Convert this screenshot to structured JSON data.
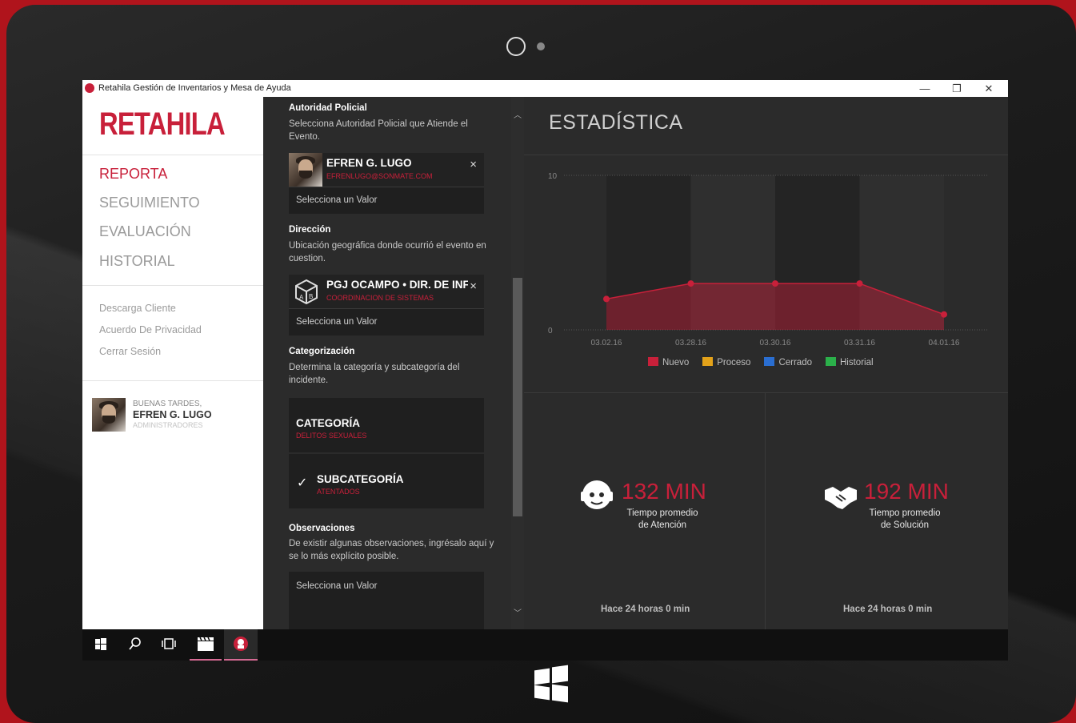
{
  "window": {
    "title": "Retahila Gestión de Inventarios y Mesa de Ayuda",
    "controls": [
      "—",
      "❐",
      "✕"
    ]
  },
  "sidebar": {
    "logo": "RETAHILA",
    "nav": [
      {
        "label": "REPORTA",
        "active": true
      },
      {
        "label": "SEGUIMIENTO",
        "active": false
      },
      {
        "label": "EVALUACIÓN",
        "active": false
      },
      {
        "label": "HISTORIAL",
        "active": false
      }
    ],
    "links": [
      "Descarga Cliente",
      "Acuerdo De Privacidad",
      "Cerrar Sesión"
    ],
    "user": {
      "greeting": "BUENAS TARDES,",
      "name": "EFREN G. LUGO",
      "role": "ADMINISTRADORES"
    }
  },
  "form": {
    "autoridad": {
      "heading": "Autoridad Policial",
      "description": "Selecciona Autoridad Policial que Atiende el Evento.",
      "card": {
        "name": "EFREN G. LUGO",
        "sub": "EFRENLUGO@SONMATE.COM"
      },
      "select": "Selecciona un Valor"
    },
    "direccion": {
      "heading": "Dirección",
      "description": "Ubicación geográfica donde ocurrió el evento en cuestion.",
      "card": {
        "name": "PGJ OCAMPO • DIR. DE INFO",
        "sub": "COORDINACION DE SISTEMAS"
      },
      "select": "Selecciona un Valor"
    },
    "categorizacion": {
      "heading": "Categorización",
      "description": "Determina la categoría y subcategoría del incidente.",
      "categoria": {
        "title": "CATEGORÍA",
        "value": "DELITOS SEXUALES"
      },
      "subcategoria": {
        "title": "SUBCATEGORÍA",
        "value": "ATENTADOS",
        "check": "✓"
      }
    },
    "observaciones": {
      "heading": "Observaciones",
      "description": "De existir algunas observaciones, ingrésalo aquí y se lo más explícito posible.",
      "select": "Selecciona un Valor"
    }
  },
  "stats": {
    "title": "ESTADÍSTICA",
    "metrics": [
      {
        "value": "132 MIN",
        "label1": "Tiempo promedio",
        "label2": "de Atención",
        "footer": "Hace 24 horas 0 min",
        "icon": "support-agent-icon"
      },
      {
        "value": "192 MIN",
        "label1": "Tiempo promedio",
        "label2": "de Solución",
        "footer": "Hace 24 horas 0 min",
        "icon": "handshake-icon"
      }
    ]
  },
  "chart_data": {
    "type": "area",
    "x": [
      "03.02.16",
      "03.28.16",
      "03.30.16",
      "03.31.16",
      "04.01.16"
    ],
    "series": [
      {
        "name": "Nuevo",
        "values": [
          2,
          3,
          3,
          3,
          1
        ],
        "color": "#c8203a"
      },
      {
        "name": "Proceso",
        "values": [],
        "color": "#e3a21a"
      },
      {
        "name": "Cerrado",
        "values": [],
        "color": "#2a6ed1"
      },
      {
        "name": "Historial",
        "values": [],
        "color": "#2bb04a"
      }
    ],
    "ylim": [
      0,
      10
    ],
    "yticks": [
      "0",
      "10"
    ],
    "legend_position": "bottom",
    "grid": true
  },
  "taskbar": {
    "icons": [
      "windows-start-icon",
      "search-icon",
      "task-view-icon",
      "clapper-icon",
      "retahila-app-icon"
    ]
  },
  "colors": {
    "accent": "#c8203a",
    "frame": "#b0141c"
  }
}
